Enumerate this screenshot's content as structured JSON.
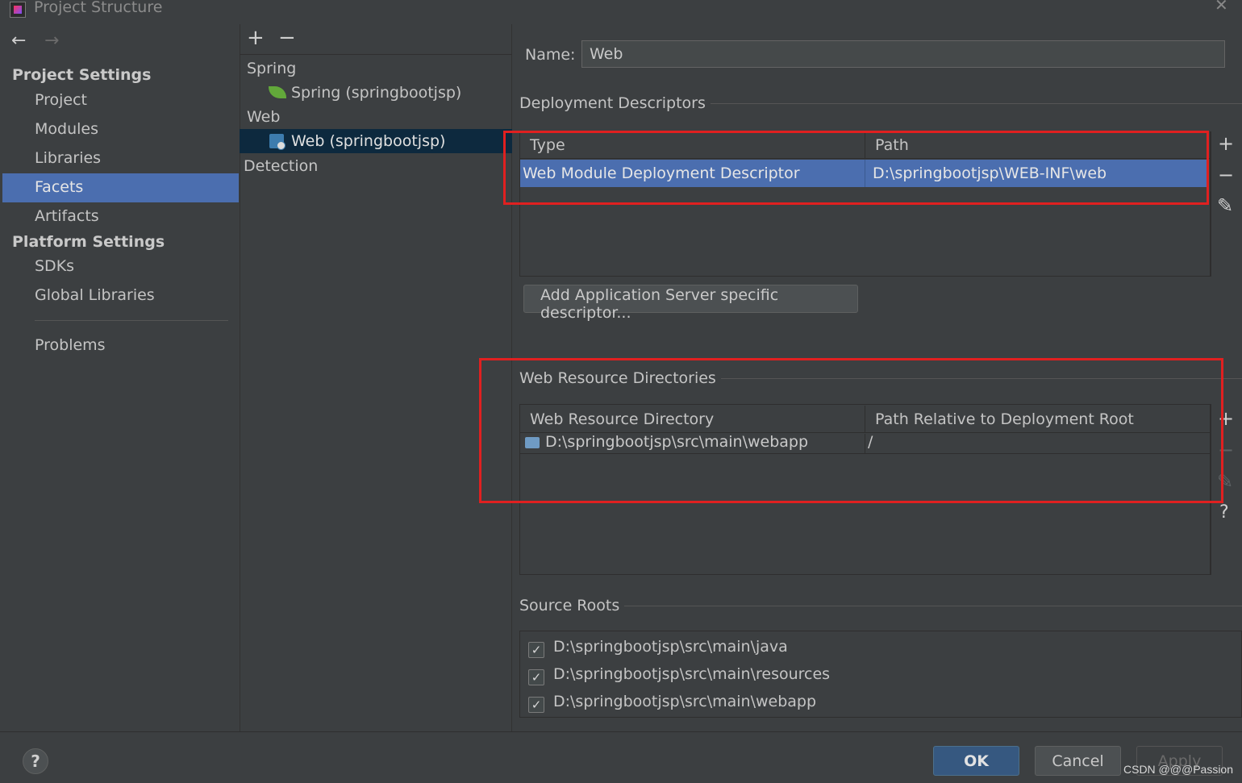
{
  "window": {
    "title": "Project Structure",
    "close": "✕"
  },
  "sidebar": {
    "back": "←",
    "forward": "→",
    "project_settings": "Project Settings",
    "items": [
      "Project",
      "Modules",
      "Libraries",
      "Facets",
      "Artifacts"
    ],
    "platform_settings": "Platform Settings",
    "platform_items": [
      "SDKs",
      "Global Libraries"
    ],
    "problems": "Problems",
    "selected": "Facets"
  },
  "facets_tree": {
    "add": "+",
    "remove": "−",
    "groups": [
      {
        "label": "Spring",
        "child": "Spring (springbootjsp)"
      },
      {
        "label": "Web",
        "child": "Web (springbootjsp)"
      }
    ],
    "detection": "Detection"
  },
  "facet": {
    "name_label": "Name:",
    "name_value": "Web",
    "deployment": {
      "title": "Deployment Descriptors",
      "columns": [
        "Type",
        "Path"
      ],
      "rows": [
        {
          "type": "Web Module Deployment Descriptor",
          "path": "D:\\springbootjsp\\WEB-INF\\web"
        }
      ],
      "add_server_button": "Add Application Server specific descriptor..."
    },
    "web_resources": {
      "title": "Web Resource Directories",
      "columns": [
        "Web Resource Directory",
        "Path Relative to Deployment Root"
      ],
      "rows": [
        {
          "dir": "D:\\springbootjsp\\src\\main\\webapp",
          "rel": "/"
        }
      ]
    },
    "source_roots": {
      "title": "Source Roots",
      "items": [
        {
          "path": "D:\\springbootjsp\\src\\main\\java",
          "checked": true
        },
        {
          "path": "D:\\springbootjsp\\src\\main\\resources",
          "checked": true
        },
        {
          "path": "D:\\springbootjsp\\src\\main\\webapp",
          "checked": true
        }
      ]
    },
    "toolbar": {
      "add": "+",
      "remove": "−",
      "edit": "✎",
      "help": "?"
    }
  },
  "buttons": {
    "help": "?",
    "ok": "OK",
    "cancel": "Cancel",
    "apply": "Apply"
  },
  "watermark": "CSDN @@@Passion",
  "colors": {
    "selection": "#4b6eaf",
    "highlight_box": "#e02020",
    "ok_button": "#365880"
  }
}
